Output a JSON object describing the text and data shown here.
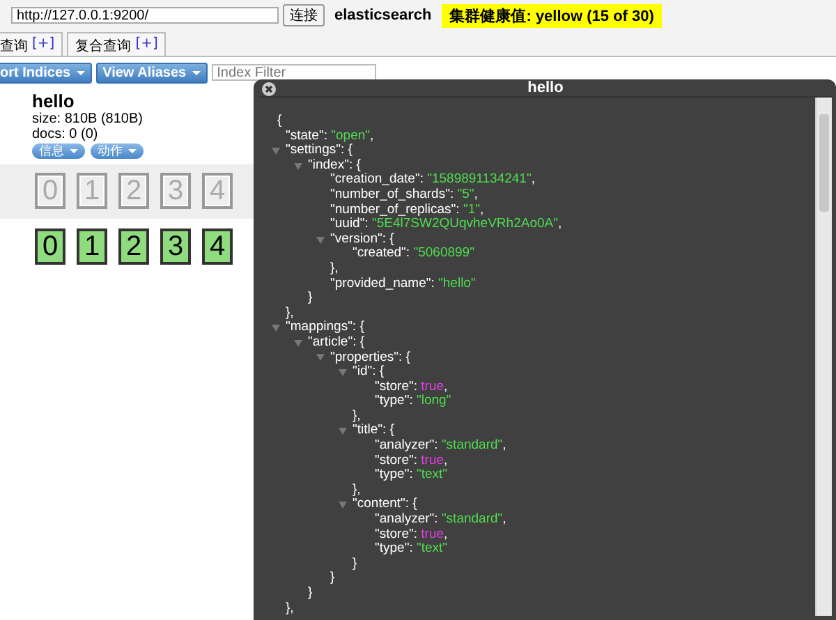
{
  "connect_bar": {
    "url": "http://127.0.0.1:9200/",
    "connect_button": "连接",
    "cluster_name": "elasticsearch",
    "health": {
      "text": "集群健康值: yellow (15 of 30)",
      "color": "#ffff00"
    }
  },
  "tabs": [
    {
      "label": "查询",
      "add": "[+]"
    },
    {
      "label": "复合查询",
      "add": "[+]"
    }
  ],
  "toolbar": {
    "buttons": [
      "ort Indices",
      "View Aliases"
    ],
    "filter": {
      "placeholder": "Index Filter"
    }
  },
  "index": {
    "name": "hello",
    "size": "size: 810B (810B)",
    "docs": "docs: 0 (0)",
    "buttons": [
      "信息",
      "动作"
    ],
    "shard_rows": [
      {
        "kind": "unassigned",
        "shards": [
          "0",
          "1",
          "2",
          "3",
          "4"
        ]
      },
      {
        "kind": "started",
        "shards": [
          "0",
          "1",
          "2",
          "3",
          "4"
        ]
      }
    ]
  },
  "dialog": {
    "title": "hello",
    "document": {
      "open": "{",
      "children": [
        {
          "kind": "string",
          "key": "\"state\":",
          "value": "\"open\"",
          "punct": ","
        },
        {
          "kind": "object",
          "key": "\"settings\":",
          "open": "{",
          "expanded": true,
          "close": "},",
          "children": [
            {
              "kind": "object",
              "key": "\"index\":",
              "open": "{",
              "expanded": true,
              "close": "}",
              "children": [
                {
                  "kind": "string",
                  "key": "\"creation_date\":",
                  "value": "\"1589891134241\"",
                  "punct": ","
                },
                {
                  "kind": "string",
                  "key": "\"number_of_shards\":",
                  "value": "\"5\"",
                  "punct": ","
                },
                {
                  "kind": "string",
                  "key": "\"number_of_replicas\":",
                  "value": "\"1\"",
                  "punct": ","
                },
                {
                  "kind": "string",
                  "key": "\"uuid\":",
                  "value": "\"5E4l7SW2QUqvheVRh2Ao0A\"",
                  "punct": ","
                },
                {
                  "kind": "object",
                  "key": "\"version\":",
                  "open": "{",
                  "expanded": true,
                  "close": "},",
                  "children": [
                    {
                      "kind": "string",
                      "key": "\"created\":",
                      "value": "\"5060899\""
                    }
                  ]
                },
                {
                  "kind": "string",
                  "key": "\"provided_name\":",
                  "value": "\"hello\""
                }
              ]
            }
          ]
        },
        {
          "kind": "object",
          "key": "\"mappings\":",
          "open": "{",
          "expanded": true,
          "close": "},",
          "children": [
            {
              "kind": "object",
              "key": "\"article\":",
              "open": "{",
              "expanded": true,
              "close": "}",
              "children": [
                {
                  "kind": "object",
                  "key": "\"properties\":",
                  "open": "{",
                  "expanded": true,
                  "close": "}",
                  "children": [
                    {
                      "kind": "object",
                      "key": "\"id\":",
                      "open": "{",
                      "expanded": true,
                      "close": "},",
                      "children": [
                        {
                          "kind": "bool",
                          "key": "\"store\":",
                          "value": "true",
                          "punct": ","
                        },
                        {
                          "kind": "string",
                          "key": "\"type\":",
                          "value": "\"long\""
                        }
                      ]
                    },
                    {
                      "kind": "object",
                      "key": "\"title\":",
                      "open": "{",
                      "expanded": true,
                      "close": "},",
                      "children": [
                        {
                          "kind": "string",
                          "key": "\"analyzer\":",
                          "value": "\"standard\"",
                          "punct": ","
                        },
                        {
                          "kind": "bool",
                          "key": "\"store\":",
                          "value": "true",
                          "punct": ","
                        },
                        {
                          "kind": "string",
                          "key": "\"type\":",
                          "value": "\"text\""
                        }
                      ]
                    },
                    {
                      "kind": "object",
                      "key": "\"content\":",
                      "open": "{",
                      "expanded": true,
                      "close": "}",
                      "children": [
                        {
                          "kind": "string",
                          "key": "\"analyzer\":",
                          "value": "\"standard\"",
                          "punct": ","
                        },
                        {
                          "kind": "bool",
                          "key": "\"store\":",
                          "value": "true",
                          "punct": ","
                        },
                        {
                          "kind": "string",
                          "key": "\"type\":",
                          "value": "\"text\""
                        }
                      ]
                    }
                  ]
                }
              ]
            }
          ]
        }
      ]
    }
  }
}
